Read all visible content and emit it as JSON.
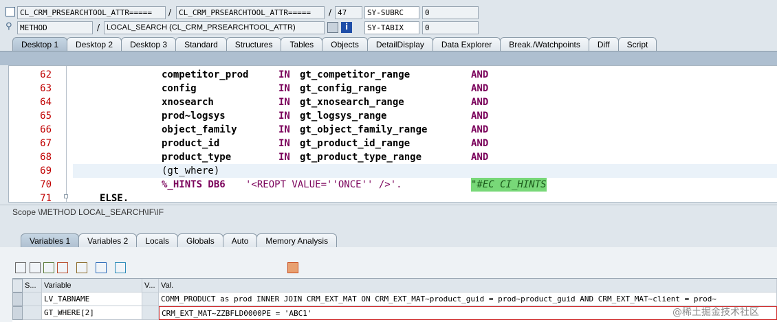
{
  "header": {
    "row1": {
      "program": "CL_CRM_PRSEARCHTOOL_ATTR=====",
      "include": "CL_CRM_PRSEARCHTOOL_ATTR=====",
      "line": "47",
      "sysfield_label": "SY-SUBRC",
      "sysfield_value": "0"
    },
    "row2": {
      "event_type": "METHOD",
      "event": "LOCAL_SEARCH (CL_CRM_PRSEARCHTOOL_ATTR)",
      "sysfield_label": "SY-TABIX",
      "sysfield_value": "0"
    },
    "separator": "/"
  },
  "tabs": [
    "Desktop 1",
    "Desktop 2",
    "Desktop 3",
    "Standard",
    "Structures",
    "Tables",
    "Objects",
    "DetailDisplay",
    "Data Explorer",
    "Break./Watchpoints",
    "Diff",
    "Script"
  ],
  "editor": {
    "lines": [
      {
        "num": "62",
        "field": "competitor_prod",
        "kw": "IN",
        "range": "gt_competitor_range",
        "and": "AND"
      },
      {
        "num": "63",
        "field": "config",
        "kw": "IN",
        "range": "gt_config_range",
        "and": "AND"
      },
      {
        "num": "64",
        "field": "xnosearch",
        "kw": "IN",
        "range": "gt_xnosearch_range",
        "and": "AND"
      },
      {
        "num": "65",
        "field": "prod~logsys",
        "kw": "IN",
        "range": "gt_logsys_range",
        "and": "AND"
      },
      {
        "num": "66",
        "field": "object_family",
        "kw": "IN",
        "range": "gt_object_family_range",
        "and": "AND"
      },
      {
        "num": "67",
        "field": "product_id",
        "kw": "IN",
        "range": "gt_product_id_range",
        "and": "AND"
      },
      {
        "num": "68",
        "field": "product_type",
        "kw": "IN",
        "range": "gt_product_type_range",
        "and": "AND"
      }
    ],
    "line69": {
      "num": "69",
      "text": "(gt_where)"
    },
    "line70": {
      "num": "70",
      "hints": "%_HINTS DB6",
      "string": "'<REOPT VALUE=''ONCE'' />'.",
      "comment": "\"#EC CI_HINTS"
    },
    "line71": {
      "num": "71",
      "text": "ELSE."
    }
  },
  "scope": "Scope \\METHOD LOCAL_SEARCH\\IF\\IF",
  "var_tabs": [
    "Variables 1",
    "Variables 2",
    "Locals",
    "Globals",
    "Auto",
    "Memory Analysis"
  ],
  "toolbar_icons": [
    "delete-icon",
    "delete-all-icon",
    "import-icon",
    "export-icon",
    "structure-icon",
    "navigate-icon",
    "settings-icon",
    "save-icon"
  ],
  "grid": {
    "headers": [
      "S...",
      "Variable",
      "V...",
      "Val."
    ],
    "rows": [
      {
        "variable": "LV_TABNAME",
        "value": "COMM_PRODUCT as prod   INNER JOIN CRM_EXT_MAT  ON CRM_EXT_MAT~product_guid = prod~product_guid  AND CRM_EXT_MAT~client = prod~"
      },
      {
        "variable": "GT_WHERE[2]",
        "value": " CRM_EXT_MAT~ZZBFLD0000PE = 'ABC1'"
      }
    ]
  },
  "watermark": "@稀土掘金技术社区",
  "colors": {
    "background": "#dfe6ec",
    "line_number": "#c00000",
    "keyword": "#7a005a",
    "comment_bg": "#78d878"
  }
}
